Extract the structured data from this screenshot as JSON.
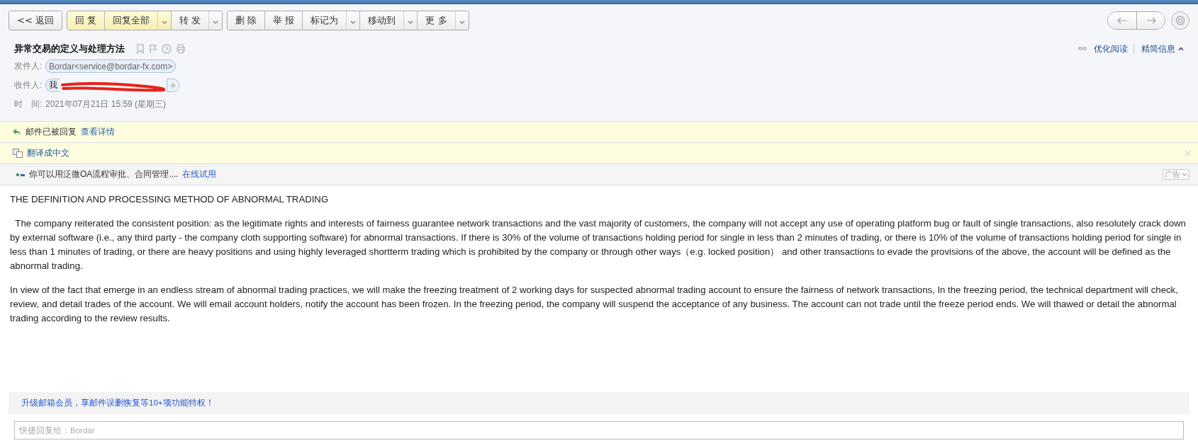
{
  "toolbar": {
    "groups": [
      {
        "buttons": [
          {
            "label": "<< 返回",
            "highlighted": false,
            "dropdown": false
          }
        ]
      },
      {
        "buttons": [
          {
            "label": "回 复",
            "highlighted": true,
            "dropdown": false
          },
          {
            "label": "回复全部",
            "highlighted": true,
            "dropdown": true
          },
          {
            "label": "转 发",
            "highlighted": false,
            "dropdown": true
          }
        ]
      },
      {
        "buttons": [
          {
            "label": "删 除",
            "highlighted": false,
            "dropdown": false
          },
          {
            "label": "举 报",
            "highlighted": false,
            "dropdown": false
          },
          {
            "label": "标记为",
            "highlighted": false,
            "dropdown": true
          },
          {
            "label": "移动到",
            "highlighted": false,
            "dropdown": true
          },
          {
            "label": "更 多",
            "highlighted": false,
            "dropdown": true
          }
        ]
      }
    ]
  },
  "header": {
    "subject": "异常交易的定义与处理方法",
    "view_links": [
      "优化阅读",
      "精简信息"
    ],
    "fields": [
      {
        "kind": "chip",
        "label": "发件人:",
        "value": "Bordar<service@bordar-fx.com>"
      },
      {
        "kind": "chip_redacted",
        "label": "收件人:",
        "value": "我"
      },
      {
        "kind": "text",
        "label": "时　间:",
        "value": "2021年07月21日 15:59 (星期三)"
      }
    ]
  },
  "notices": [
    {
      "kind": "replied",
      "text": "邮件已被回复",
      "link": "查看详情"
    },
    {
      "kind": "translate",
      "link": "翻译成中文"
    }
  ],
  "ad_bar": {
    "text": "你可以用泛微OA流程审批、合同管理....",
    "link": "在线试用",
    "tag": "广告"
  },
  "body": {
    "heading": "THE DEFINITION AND PROCESSING METHOD OF ABNORMAL TRADING",
    "paragraphs": [
      "  The company reiterated the consistent position: as the legitimate rights and interests of fairness guarantee network transactions and the vast majority of customers, the company will not accept any use of operating platform bug or fault of single transactions, also resolutely crack down by external software (i.e., any third party - the company cloth supporting software) for abnormal transactions. If there is 30% of the volume of transactions holding period for single in less than 2 minutes of trading, or there is 10% of the volume of transactions holding period for single in less than 1 minutes of trading, or there are heavy positions and using highly leveraged shortterm trading which is prohibited by the company or through other ways（e.g. locked position） and other transactions to evade the provisions of the above, the account will be defined as the abnormal trading.",
      "In view of the fact that emerge in an endless stream of abnormal trading practices, we will make the freezing treatment of 2 working days for suspected abnormal trading account to ensure the fairness of network transactions, In the freezing period, the technical department will check, review, and detail trades of the account. We will email account holders, notify the account has been frozen. In the freezing period, the company will suspend the acceptance of any business. The account can not trade until the freeze period ends. We will thawed or detail the abnormal trading according to the review results."
    ]
  },
  "upgrade_link": "升级邮箱会员，享邮件误删恢复等10+项功能特权！",
  "quick_reply": {
    "placeholder": "快捷回复给：Bordar"
  }
}
